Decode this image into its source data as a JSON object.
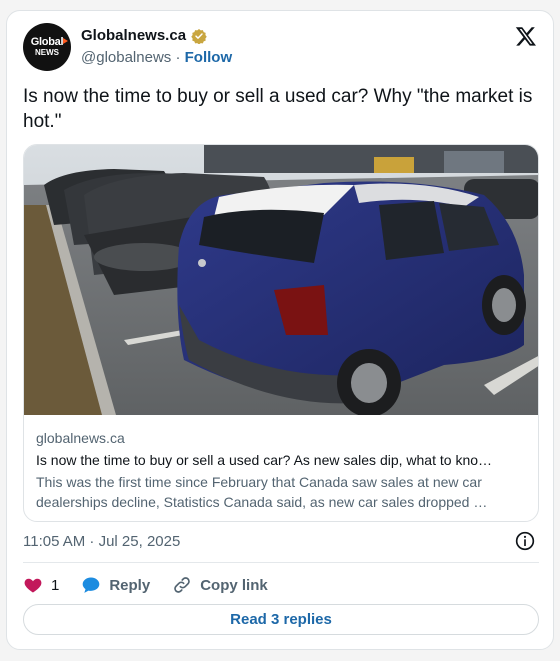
{
  "author": {
    "avatar_line1": "Global",
    "avatar_line2": "NEWS",
    "name": "Globalnews.ca",
    "handle": "@globalnews",
    "separator": "·",
    "follow_label": "Follow",
    "verified": true
  },
  "tweet": {
    "text": "Is now the time to buy or sell a used car? Why \"the market is hot.\""
  },
  "link_card": {
    "domain": "globalnews.ca",
    "headline": "Is now the time to buy or sell a used car? As new sales dip, what to kno…",
    "description_line1": "This was the first time since February that Canada saw sales at new car",
    "description_line2": "dealerships decline, Statistics Canada said, as new car sales dropped …"
  },
  "timestamp": "11:05 AM · Jul 25, 2025",
  "actions": {
    "like_count": "1",
    "reply_label": "Reply",
    "copy_link_label": "Copy link"
  },
  "read_replies_label": "Read 3 replies",
  "colors": {
    "accent": "#1d68a8",
    "heart": "#c2185b",
    "verified_badge": "#c9a640",
    "reply_bubble": "#1d8ce0"
  },
  "icons": [
    "x-logo-icon",
    "verified-badge-icon",
    "info-icon",
    "heart-icon",
    "reply-bubble-icon",
    "link-icon"
  ]
}
